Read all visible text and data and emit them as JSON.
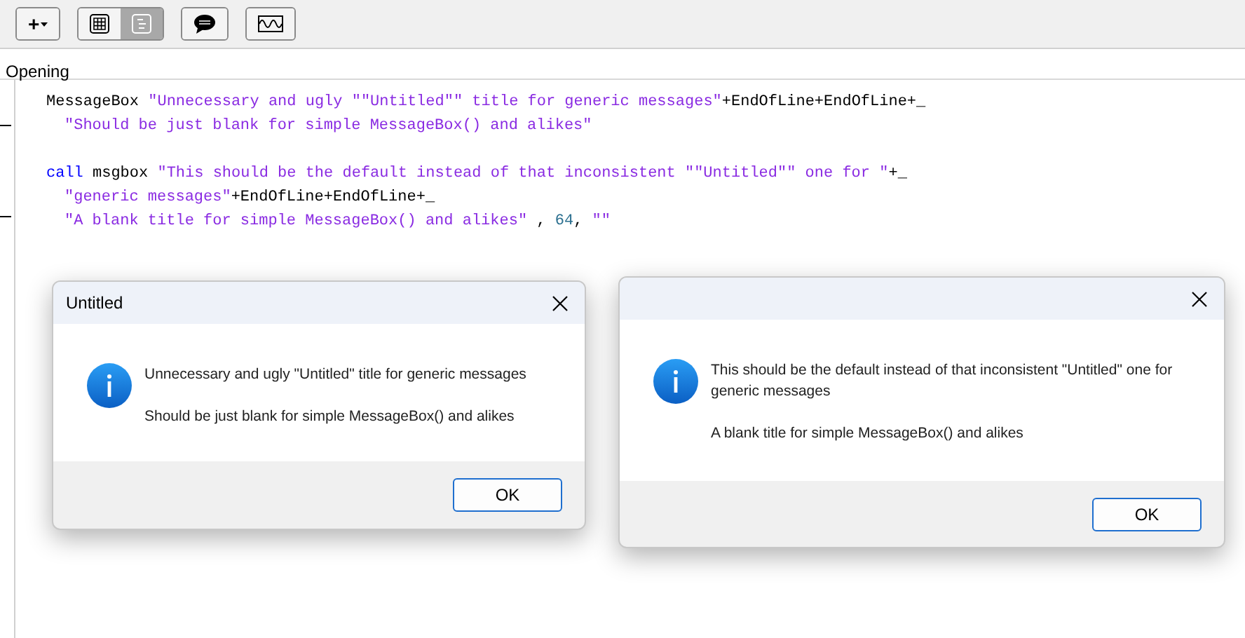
{
  "toolbar": {
    "groups": [
      {
        "buttons": [
          {
            "kind": "add",
            "label": "+",
            "selected": false
          }
        ]
      },
      {
        "buttons": [
          {
            "kind": "grid",
            "selected": false
          },
          {
            "kind": "outline",
            "selected": true
          }
        ]
      },
      {
        "buttons": [
          {
            "kind": "comment",
            "selected": false
          }
        ]
      },
      {
        "buttons": [
          {
            "kind": "wave",
            "selected": false
          }
        ]
      }
    ]
  },
  "section_label": "Opening",
  "code": [
    {
      "kind": "code",
      "indented": false,
      "tokens": [
        {
          "kind": "plain",
          "text": "MessageBox "
        },
        {
          "kind": "string",
          "text": "\"Unnecessary and ugly \"\"Untitled\"\" title for generic messages\""
        },
        {
          "kind": "plain",
          "text": "+EndOfLine+EndOfLine+_"
        }
      ]
    },
    {
      "kind": "code",
      "indented": true,
      "tokens": [
        {
          "kind": "string",
          "text": "\"Should be just blank for simple MessageBox() and alikes\""
        }
      ]
    },
    {
      "kind": "blank"
    },
    {
      "kind": "code",
      "indented": false,
      "tokens": [
        {
          "kind": "keyword",
          "text": "call"
        },
        {
          "kind": "plain",
          "text": " msgbox "
        },
        {
          "kind": "string",
          "text": "\"This should be the default instead of that inconsistent \"\"Untitled\"\" one for \""
        },
        {
          "kind": "plain",
          "text": "+_"
        }
      ]
    },
    {
      "kind": "code",
      "indented": true,
      "tokens": [
        {
          "kind": "string",
          "text": "\"generic messages\""
        },
        {
          "kind": "plain",
          "text": "+EndOfLine+EndOfLine+_"
        }
      ]
    },
    {
      "kind": "code",
      "indented": true,
      "tokens": [
        {
          "kind": "string",
          "text": "\"A blank title for simple MessageBox() and alikes\""
        },
        {
          "kind": "plain",
          "text": " , "
        },
        {
          "kind": "number",
          "text": "64"
        },
        {
          "kind": "plain",
          "text": ", "
        },
        {
          "kind": "string",
          "text": "\"\""
        }
      ]
    }
  ],
  "dialogs": [
    {
      "title": "Untitled",
      "messages": [
        "Unnecessary and ugly \"Untitled\" title for generic messages",
        "Should be just blank for simple MessageBox() and alikes"
      ],
      "button": "OK"
    },
    {
      "messages": [
        "This should be the default instead of that inconsistent \"Untitled\" one for generic messages",
        "A blank title for simple MessageBox() and alikes"
      ],
      "button": "OK"
    }
  ]
}
